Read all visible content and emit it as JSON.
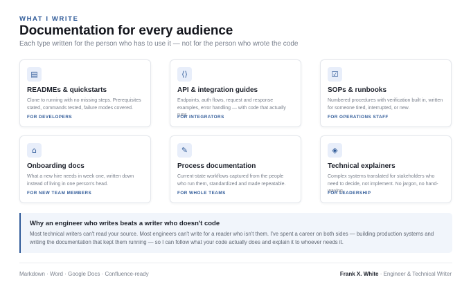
{
  "header": {
    "eyebrow": "WHAT I WRITE",
    "title": "Documentation for every audience",
    "subtitle": "Each type written for the person who has to use it — not for the person who wrote the code"
  },
  "cards": [
    {
      "icon": "document-lines-icon",
      "glyph": "▤",
      "title": "READMEs & quickstarts",
      "description": "Clone to running with no missing steps. Prerequisites stated, commands tested, failure modes covered.",
      "audience": "FOR DEVELOPERS"
    },
    {
      "icon": "code-brackets-icon",
      "glyph": "⟨⟩",
      "title": "API & integration guides",
      "description": "Endpoints, auth flows, request and response examples, error handling — with code that actually runs.",
      "audience": "FOR INTEGRATORS"
    },
    {
      "icon": "checkbox-icon",
      "glyph": "☑",
      "title": "SOPs & runbooks",
      "description": "Numbered procedures with verification built in, written for someone tired, interrupted, or new.",
      "audience": "FOR OPERATIONS STAFF"
    },
    {
      "icon": "home-icon",
      "glyph": "⌂",
      "title": "Onboarding docs",
      "description": "What a new hire needs in week one, written down instead of living in one person's head.",
      "audience": "FOR NEW TEAM MEMBERS"
    },
    {
      "icon": "pencil-icon",
      "glyph": "✎",
      "title": "Process documentation",
      "description": "Current-state workflows captured from the people who run them, standardized and made repeatable.",
      "audience": "FOR WHOLE TEAMS"
    },
    {
      "icon": "diamond-icon",
      "glyph": "◈",
      "title": "Technical explainers",
      "description": "Complex systems translated for stakeholders who need to decide, not implement. No jargon, no hand-waving.",
      "audience": "FOR LEADERSHIP"
    }
  ],
  "callout": {
    "title": "Why an engineer who writes beats a writer who doesn't code",
    "body": "Most technical writers can't read your source. Most engineers can't write for a reader who isn't them. I've spent a career on both sides — building production systems and writing the documentation that kept them running — so I can follow what your code actually does and explain it to whoever needs it."
  },
  "footer": {
    "formats": "Markdown · Word · Google Docs · Confluence-ready",
    "name": "Frank X. White",
    "role": " · Engineer & Technical Writer"
  },
  "colors": {
    "accent": "#2f5a98",
    "icon_bg": "#e8eefa",
    "callout_bg": "#f1f5fb"
  }
}
